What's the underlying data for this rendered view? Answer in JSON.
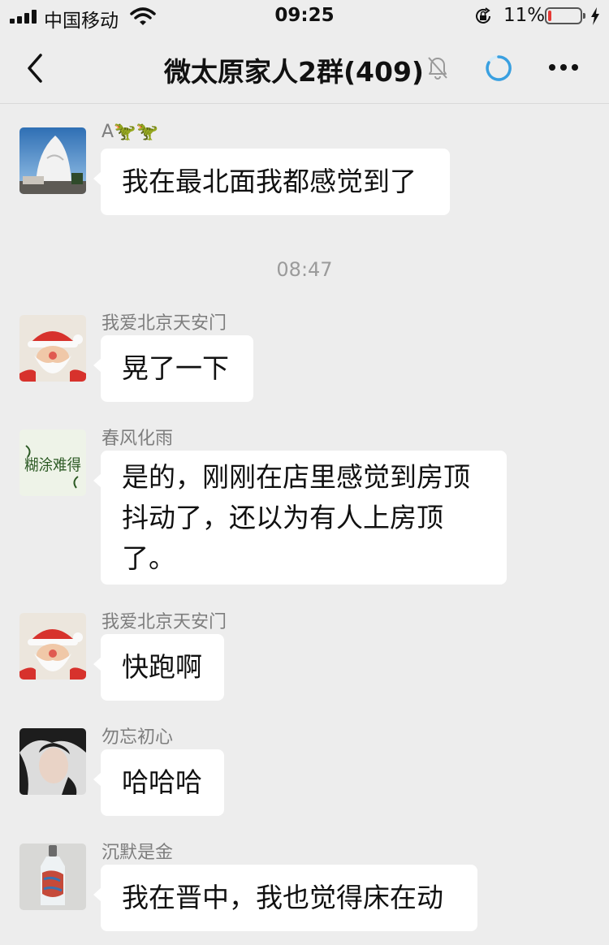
{
  "status_bar": {
    "carrier": "中国移动",
    "time": "09:25",
    "battery_percent": "11%",
    "battery_level": 0.11,
    "icons": [
      "signal-icon",
      "wifi-icon",
      "orientation-lock-icon",
      "battery-icon",
      "charging-icon"
    ]
  },
  "nav": {
    "title": "微太原家人2群(409)",
    "icons": [
      "back-icon",
      "mute-icon",
      "loading-icon",
      "more-icon"
    ]
  },
  "chat": {
    "timestamp": "08:47",
    "messages": [
      {
        "sender": "A🦖🦖",
        "text": "我在最北面我都感觉到了"
      },
      {
        "sender": "我爱北京天安门",
        "text": "晃了一下"
      },
      {
        "sender": "春风化雨",
        "lines": [
          "是的，刚刚在店里感觉到房顶",
          "抖动了，还以为有人上房顶",
          "了。"
        ]
      },
      {
        "sender": "我爱北京天安门",
        "text": "快跑啊"
      },
      {
        "sender": "勿忘初心",
        "text": "哈哈哈"
      },
      {
        "sender": "沉默是金",
        "text": "我在晋中，我也觉得床在动"
      }
    ]
  },
  "avatar_art": {
    "calligraphy": "糊涂难得"
  },
  "colors": {
    "background": "#ededed",
    "bubble": "#ffffff",
    "battery_low": "#e53935",
    "loading_ring": "#3aa0e0"
  }
}
